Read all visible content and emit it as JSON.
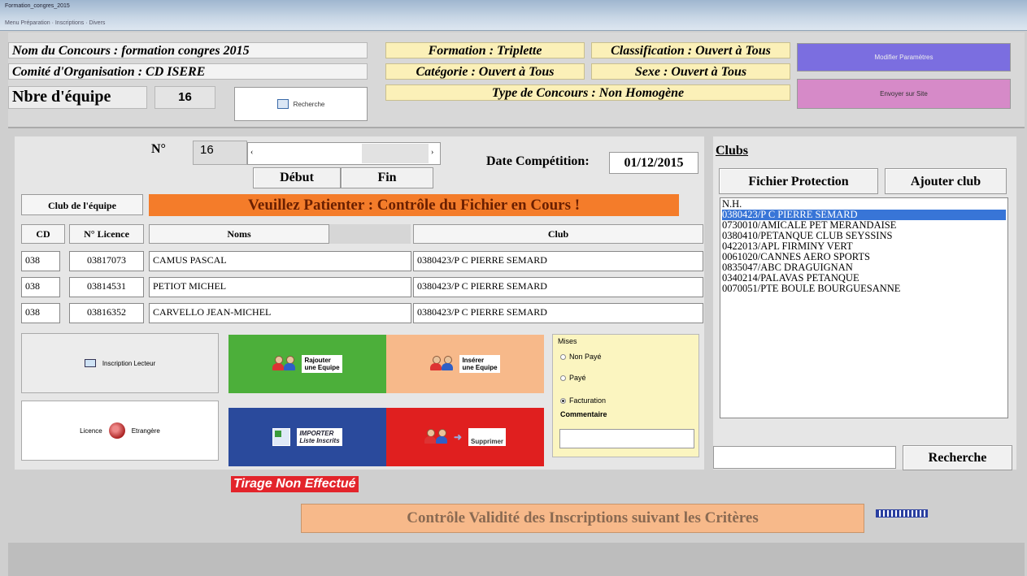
{
  "window": {
    "title": "Formation_congres_2015",
    "menu": "Menu Préparation · Inscriptions · Divers"
  },
  "header": {
    "nom_concours": "Nom du Concours : formation  congres  2015",
    "comite": "Comité d'Organisation : CD ISERE",
    "nbre_label": "Nbre d'équipe",
    "nbre_value": "16",
    "recherche_label": "Recherche",
    "formation": "Formation : Triplette",
    "classification": "Classification : Ouvert à Tous",
    "categorie": "Catégorie : Ouvert à Tous",
    "sexe": "Sexe : Ouvert à Tous",
    "type": "Type de Concours : Non Homogène",
    "modifier_btn": "Modifier Paramètres",
    "envoyer_btn": "Envoyer sur Site",
    "colors": {
      "modifier": "#7b6ee0",
      "envoyer": "#d68ac8",
      "yellow": "#fbf0b8"
    }
  },
  "team": {
    "no_label": "N°",
    "no_value": "16",
    "debut": "Début",
    "fin": "Fin",
    "date_label": "Date Compétition:",
    "date_value": "01/12/2015",
    "club_equipe": "Club de l'équipe",
    "banner": "Veuillez Patienter : Contrôle du Fichier en Cours !",
    "columns": [
      "CD",
      "N° Licence",
      "Noms",
      "Club"
    ],
    "rows": [
      {
        "cd": "038",
        "licence": "03817073",
        "nom": "CAMUS PASCAL",
        "club": "0380423/P C PIERRE SEMARD"
      },
      {
        "cd": "038",
        "licence": "03814531",
        "nom": "PETIOT MICHEL",
        "club": "0380423/P C PIERRE SEMARD"
      },
      {
        "cd": "038",
        "licence": "03816352",
        "nom": "CARVELLO JEAN-MICHEL",
        "club": "0380423/P C PIERRE SEMARD"
      }
    ]
  },
  "actions": {
    "inscription_lecteur": "Inscription Lecteur",
    "licence_etrangere_a": "Licence",
    "licence_etrangere_b": "Etrangère",
    "rajouter_a": "Rajouter",
    "rajouter_b": "une Equipe",
    "inserer_a": "Insérer",
    "inserer_b": "une Equipe",
    "importer_a": "IMPORTER",
    "importer_b": "Liste Inscrits",
    "supprimer": "Supprimer",
    "colors": {
      "green": "#4caf3a",
      "peach": "#f7b98a",
      "blue": "#2a4a9c",
      "red": "#e01f1f"
    }
  },
  "mises": {
    "title": "Mises",
    "options": [
      "Non Payé",
      "Payé",
      "Facturation"
    ],
    "selected": "Facturation",
    "commentaire": "Commentaire"
  },
  "clubs": {
    "title": "Clubs",
    "fichier_protection": "Fichier Protection",
    "ajouter_club": "Ajouter club",
    "list": [
      "N.H.",
      "0380423/P C PIERRE SEMARD",
      "0730010/AMICALE PET MERANDAISE",
      "0380410/PETANQUE CLUB SEYSSINS",
      "0422013/APL FIRMINY VERT",
      "0061020/CANNES AERO SPORTS",
      "0835047/ABC DRAGUIGNAN",
      "0340214/PALAVAS PETANQUE",
      "0070051/PTE BOULE BOURGUESANNE"
    ],
    "selected_index": 1,
    "recherche": "Recherche"
  },
  "footer": {
    "tirage": "Tirage Non Effectué",
    "controle": "Contrôle Validité des Inscriptions suivant les Critères"
  }
}
